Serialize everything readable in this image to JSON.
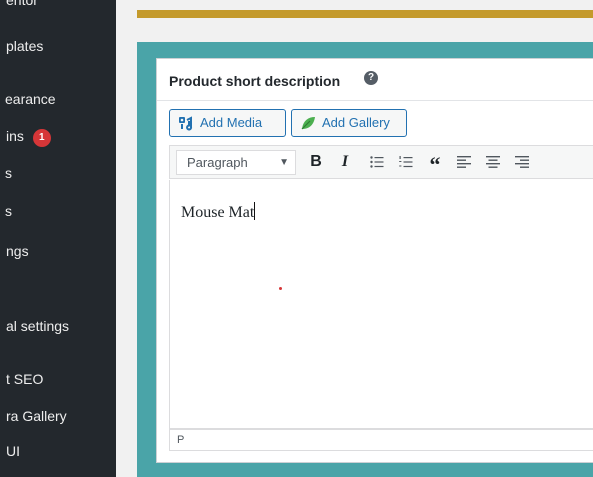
{
  "sidebar": {
    "items": [
      {
        "label": "entor"
      },
      {
        "label": "plates"
      },
      {
        "label": "earance"
      },
      {
        "label": "ins",
        "badge": "1"
      },
      {
        "label": "s"
      },
      {
        "label": "s"
      },
      {
        "label": "ngs"
      },
      {
        "label": "al settings"
      },
      {
        "label": "t SEO"
      },
      {
        "label": "ra Gallery"
      },
      {
        "label": "UI"
      }
    ]
  },
  "metabox": {
    "title": "Product short description",
    "help_icon": "?"
  },
  "media_buttons": {
    "add_media": "Add Media",
    "add_gallery": "Add Gallery"
  },
  "toolbar": {
    "format_value": "Paragraph",
    "bold": "B",
    "italic": "I"
  },
  "editor": {
    "content": "Mouse Mat"
  },
  "statusbar": {
    "path": "P"
  },
  "colors": {
    "sidebar_bg": "#23282d",
    "accent_teal": "#4aa4a8",
    "accent_gold": "#c49a2c",
    "link_blue": "#2271b1",
    "badge_red": "#d63638"
  }
}
